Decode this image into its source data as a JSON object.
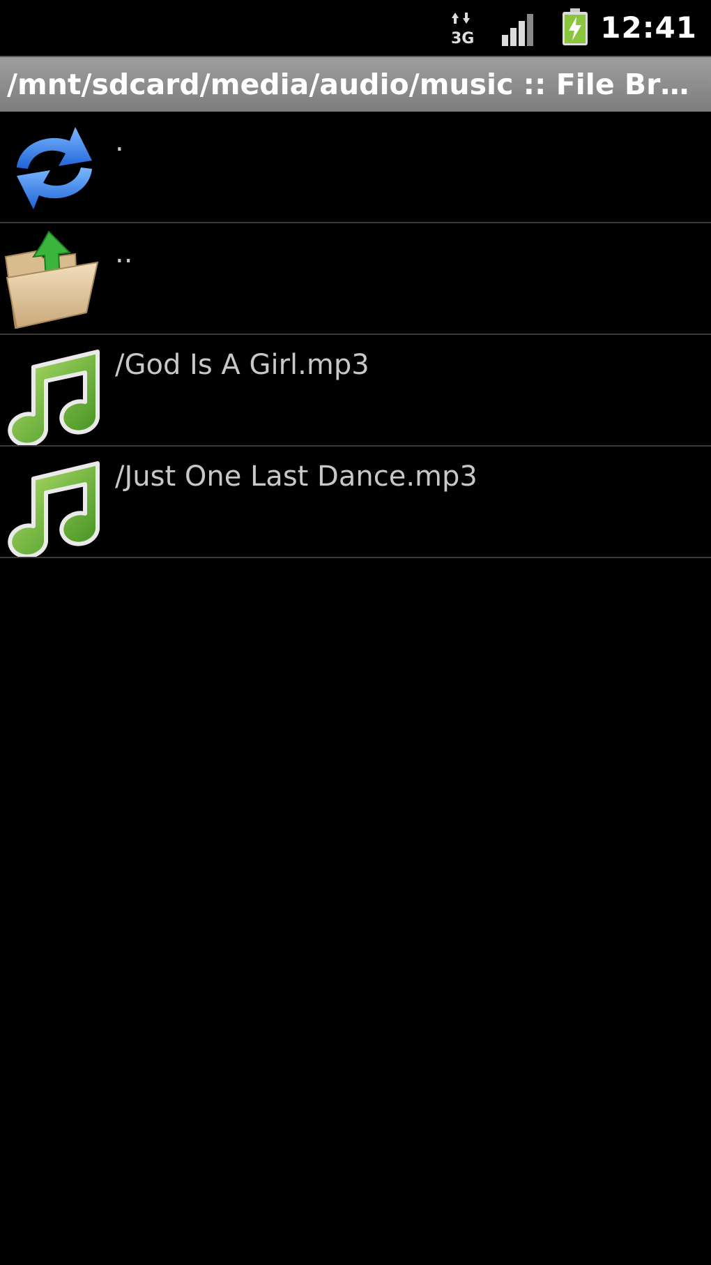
{
  "status_bar": {
    "network_type": "3G",
    "network_icon": "data-3g-icon",
    "signal_icon": "signal-strength-icon",
    "battery_icon": "battery-charging-icon",
    "time": "12:41"
  },
  "title_bar": {
    "title": "/mnt/sdcard/media/audio/music :: File Browser"
  },
  "file_list": {
    "items": [
      {
        "label": ".",
        "icon": "refresh-icon"
      },
      {
        "label": "..",
        "icon": "folder-up-icon"
      },
      {
        "label": "/God Is A Girl.mp3",
        "icon": "music-note-icon"
      },
      {
        "label": "/Just One Last Dance.mp3",
        "icon": "music-note-icon"
      }
    ]
  },
  "colors": {
    "background": "#000000",
    "title_bar": "#8c8c8c",
    "item_text": "#c8c8c8",
    "divider": "#3a3a3a",
    "music_green": "#6db33f",
    "refresh_blue": "#2f7fe0"
  }
}
